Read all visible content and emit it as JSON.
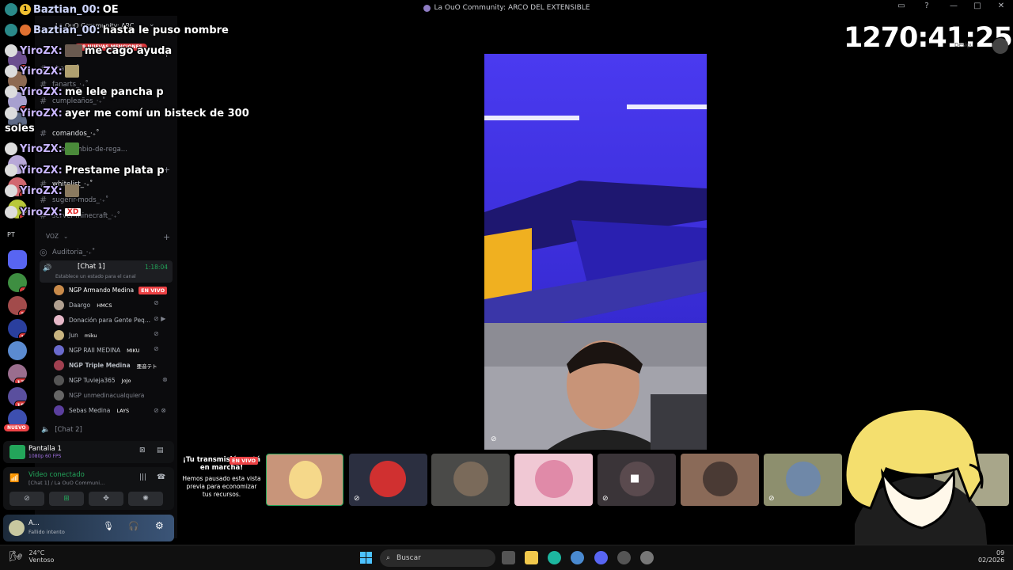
{
  "window": {
    "title": "La OuO Community: ARCO DEL EXTENSIBLE",
    "controls": [
      "—",
      "□",
      "✕"
    ]
  },
  "chat_overlay": [
    {
      "user": "Baztian_00:",
      "text": "OE",
      "badge": "1"
    },
    {
      "user": "Baztian_00:",
      "text": "hasta le puso nombre"
    },
    {
      "user": "YiroZX:",
      "text": "me cago ayuda",
      "emote": true
    },
    {
      "user": "YiroZX:",
      "text": "",
      "emote": true
    },
    {
      "user": "YiroZX:",
      "text": "me lele pancha p"
    },
    {
      "user": "YiroZX:",
      "text": "ayer me comí un bisteck de 300"
    },
    {
      "user": "",
      "text": "soles"
    },
    {
      "user": "YiroZX:",
      "text": "",
      "emote": true
    },
    {
      "user": "YiroZX:",
      "text": "Prestame plata p"
    },
    {
      "user": "YiroZX:",
      "text": "",
      "emote": true
    },
    {
      "user": "YiroZX:",
      "text": "XD",
      "emote": true
    }
  ],
  "server": {
    "name": "La OuO Community: ARC",
    "mentions_banner": "49 NUEVAS MENCIONES"
  },
  "channels": [
    {
      "name": "chat_‧₊˚",
      "bright": false
    },
    {
      "name": "fanarts_‧₊˚",
      "bright": false
    },
    {
      "name": "cumpleaños_‧₊˚",
      "bright": false
    },
    {
      "name": "comandos_‧₊˚",
      "bright": true
    },
    {
      "name": "intercambio-de-rega...",
      "bright": false
    },
    {
      "name": "whitelist_‧₊˚",
      "bright": true
    },
    {
      "name": "sugerir-mods_‧₊˚",
      "bright": false
    },
    {
      "name": "server-minecraft_‧₊˚",
      "bright": false
    }
  ],
  "voice_category": "VOZ",
  "voice_channels": {
    "auditoria": "Auditoria_‧₊˚",
    "chat1": "[Chat 1]",
    "chat1_timer": "1:18:04",
    "chat1_status": "Establece un estado para el canal",
    "chat2": "[Chat 2]"
  },
  "voice_users": [
    {
      "name": "NGP Armando Medina",
      "tag": "",
      "live": "EN VIVO"
    },
    {
      "name": "Daargo",
      "tag": "HMCS"
    },
    {
      "name": "Donación para Gente Peq...",
      "tag": ""
    },
    {
      "name": "Jun",
      "tag": "miku"
    },
    {
      "name": "NGP RAII MEDINA",
      "tag": "MIKU"
    },
    {
      "name": "NGP Triple Medina",
      "tag": "亜音テト"
    },
    {
      "name": "NGP Tuvieja365",
      "tag": "JoJo"
    },
    {
      "name": "NGP unmedinacualquiera",
      "tag": ""
    },
    {
      "name": "Sebas Medina",
      "tag": "LAYS"
    }
  ],
  "server_badges": [
    "PT",
    "2",
    "33",
    "18",
    "179",
    "180",
    "NUEVO"
  ],
  "stream_panel": {
    "title": "Pantalla 1",
    "sub": "1080p 60 FPS"
  },
  "voice_panel": {
    "status": "Video conectado",
    "location": "[Chat 1] / La OuO Communi..."
  },
  "user_panel": {
    "name": "A...",
    "status": "Fallido intento"
  },
  "timer": "1270:41:25",
  "timer_label": "Desigu",
  "paused_card": {
    "head": "¡Tu transmisión está en marcha!",
    "live": "EN VIVO",
    "body": "Hemos pausado esta vista previa para economizar tus recursos."
  },
  "taskbar": {
    "temp": "24°C",
    "weather": "Ventoso",
    "search": "Buscar",
    "time": "09",
    "date": "02/2026"
  },
  "colors": {
    "accent_live": "#ed4245",
    "video_blue": "#3b35d9",
    "connected_green": "#23a55a"
  }
}
